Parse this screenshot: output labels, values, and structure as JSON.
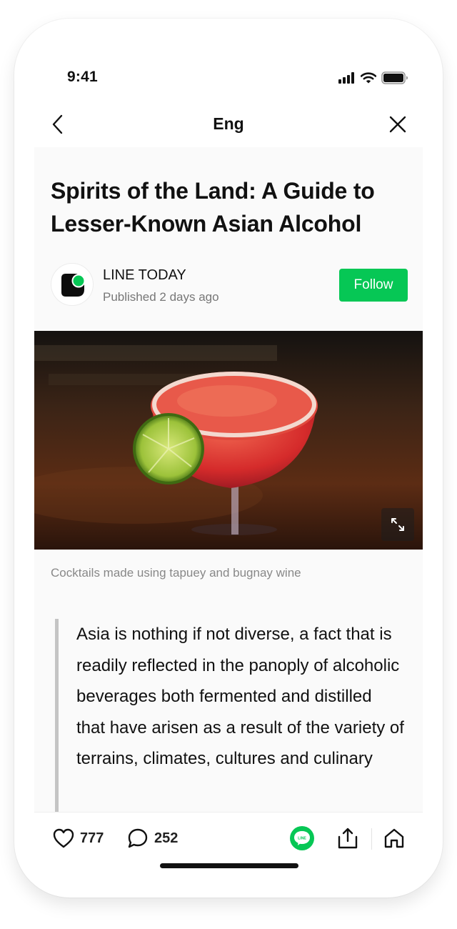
{
  "status_bar": {
    "time": "9:41"
  },
  "nav": {
    "title": "Eng"
  },
  "article": {
    "headline": "Spirits of the Land: A Guide to Lesser-Known Asian Alcohol",
    "publisher": {
      "name": "LINE TODAY",
      "published": "Published 2 days ago",
      "follow_label": "Follow"
    },
    "image_caption": "Cocktails made using tapuey and bugnay wine",
    "quote": "Asia is nothing if not diverse, a fact that is readily reflected in the panoply of alcoholic beverages both fermented and distilled that have arisen as a result of the variety of terrains, climates, cultures and culinary"
  },
  "actions": {
    "likes": "777",
    "comments": "252",
    "line_badge": "LINE"
  },
  "colors": {
    "accent_green": "#06c755",
    "quote_bar": "#c4c4c4",
    "background": "#fafafa"
  },
  "icons": [
    "signal-icon",
    "wifi-icon",
    "battery-icon",
    "back-icon",
    "close-icon",
    "expand-icon",
    "heart-icon",
    "comment-icon",
    "line-icon",
    "share-icon",
    "home-icon"
  ]
}
